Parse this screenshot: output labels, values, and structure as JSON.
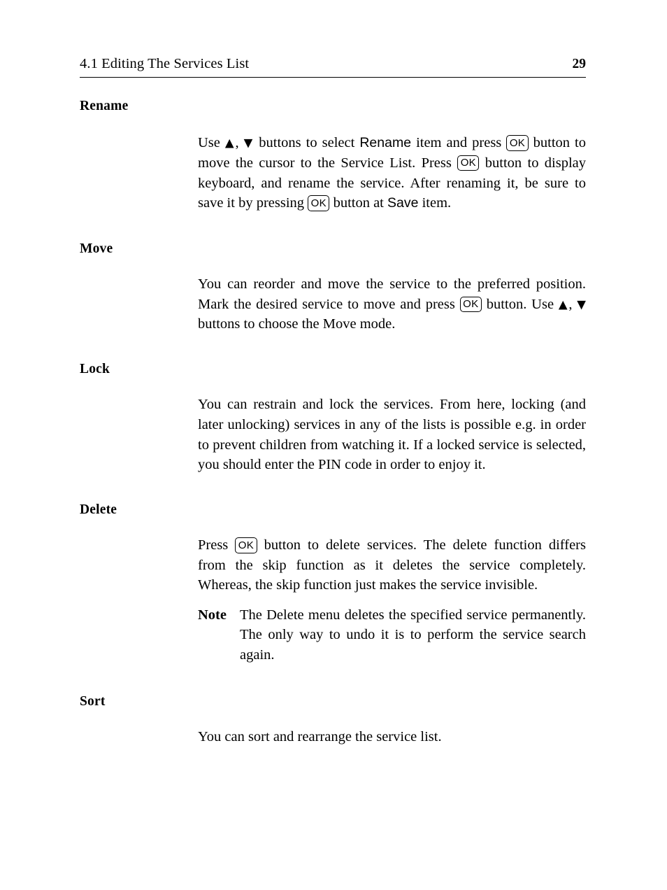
{
  "header": {
    "title": "4.1 Editing The Services List",
    "page_number": "29"
  },
  "icons": {
    "up_arrow": "▲",
    "down_arrow": "▼",
    "ok_button_label": "OK"
  },
  "sections": [
    {
      "heading": "Rename",
      "paragraph_parts": {
        "p1_a": "Use ",
        "p1_b": ", ",
        "p1_c": " buttons to select ",
        "p1_term1": "Rename",
        "p1_d": " item and press ",
        "p1_e": " button to move the cursor to the Service List.  Press ",
        "p1_f": " button to display keyboard, and rename the service.  After renaming it, be sure to save it by pressing ",
        "p1_g": " button at ",
        "p1_term2": "Save",
        "p1_h": " item."
      }
    },
    {
      "heading": "Move",
      "paragraph_parts": {
        "p1_a": "You can reorder and move the service to the preferred position. Mark the desired service to move and press ",
        "p1_b": " button. Use ",
        "p1_c": ", ",
        "p1_d": " buttons to choose the Move mode."
      }
    },
    {
      "heading": "Lock",
      "paragraph_parts": {
        "p1_full": "You can restrain and lock the services. From here, locking (and later unlocking) services in any of the lists is possible e.g.  in order to prevent children from watching it. If a locked service is selected, you should enter the PIN code in order to enjoy it."
      }
    },
    {
      "heading": "Delete",
      "paragraph_parts": {
        "p1_a": "Press ",
        "p1_b": " button to delete services.  The delete function differs from the skip function as it deletes the service completely. Whereas, the skip function just makes the service invisible."
      },
      "note": {
        "label": "Note",
        "text": "The Delete menu deletes the specified service permanently. The only way to undo it is to perform the service search again."
      }
    },
    {
      "heading": "Sort",
      "paragraph_parts": {
        "p1_full": "You can sort and rearrange the service list."
      }
    }
  ]
}
